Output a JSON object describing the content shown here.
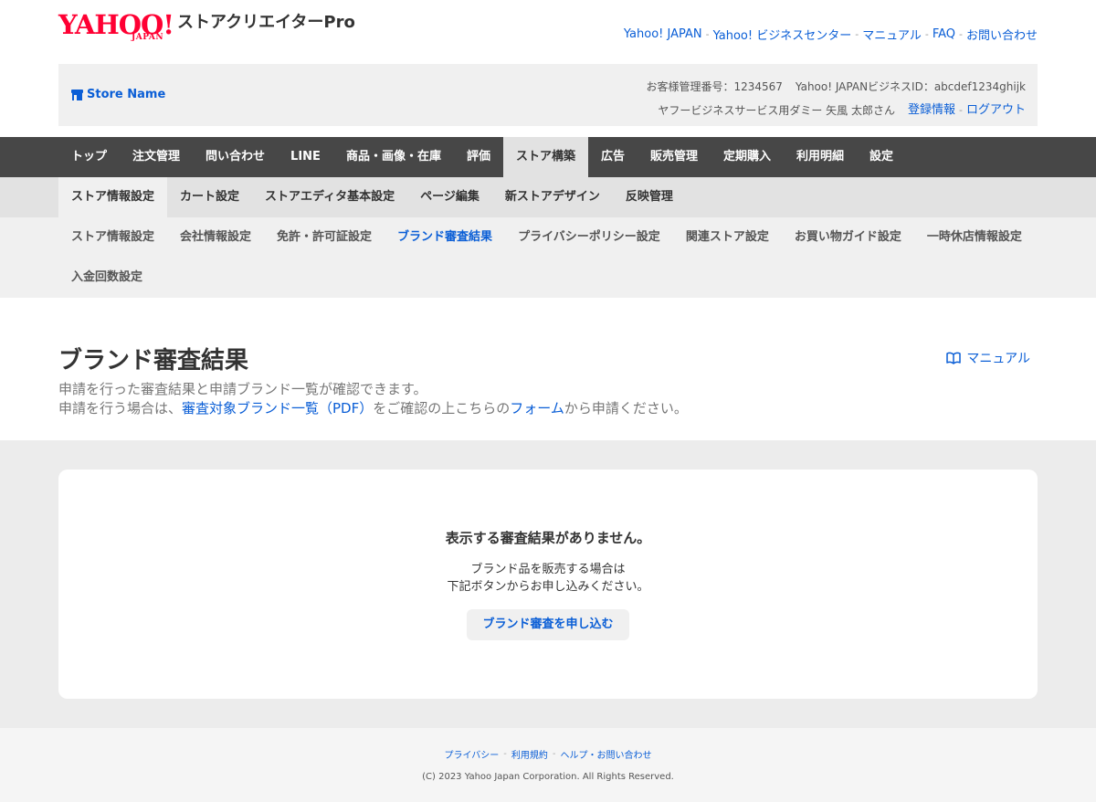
{
  "header": {
    "logo_text": "YAHOO!",
    "logo_japan": "JAPAN",
    "logo_sub": "ストアクリエイターPro",
    "links": [
      {
        "label": "Yahoo! JAPAN"
      },
      {
        "label": "Yahoo! ビジネスセンター"
      },
      {
        "label": "マニュアル"
      },
      {
        "label": "FAQ"
      },
      {
        "label": "お問い合わせ"
      }
    ]
  },
  "store": {
    "name": "Store Name",
    "customer_no": "お客様管理番号：1234567",
    "business_id": "Yahoo! JAPANビジネスID：abcdef1234ghijk",
    "user": "ヤフービジネスサービス用ダミー 矢風 太郎さん",
    "registration_label": "登録情報",
    "logout_label": "ログアウト"
  },
  "nav_main": [
    {
      "label": "トップ"
    },
    {
      "label": "注文管理"
    },
    {
      "label": "問い合わせ"
    },
    {
      "label": "LINE"
    },
    {
      "label": "商品・画像・在庫"
    },
    {
      "label": "評価"
    },
    {
      "label": "ストア構築"
    },
    {
      "label": "広告"
    },
    {
      "label": "販売管理"
    },
    {
      "label": "定期購入"
    },
    {
      "label": "利用明細"
    },
    {
      "label": "設定"
    }
  ],
  "nav_sub": [
    {
      "label": "ストア情報設定"
    },
    {
      "label": "カート設定"
    },
    {
      "label": "ストアエディタ基本設定"
    },
    {
      "label": "ページ編集"
    },
    {
      "label": "新ストアデザイン"
    },
    {
      "label": "反映管理"
    }
  ],
  "nav_third": [
    {
      "label": "ストア情報設定"
    },
    {
      "label": "会社情報設定"
    },
    {
      "label": "免許・許可証設定"
    },
    {
      "label": "ブランド審査結果"
    },
    {
      "label": "プライバシーポリシー設定"
    },
    {
      "label": "関連ストア設定"
    },
    {
      "label": "お買い物ガイド設定"
    },
    {
      "label": "一時休店情報設定"
    },
    {
      "label": "入金回数設定"
    }
  ],
  "page": {
    "title": "ブランド審査結果",
    "manual_label": "マニュアル",
    "desc_line1": "申請を行った審査結果と申請ブランド一覧が確認できます。",
    "desc_line2_pre": "申請を行う場合は、",
    "desc_link_pdf": "審査対象ブランド一覧（PDF）",
    "desc_line2_mid": "をご確認の上こちらの",
    "desc_link_form": "フォーム",
    "desc_line2_post": "から申請ください。"
  },
  "empty": {
    "title": "表示する審査結果がありません。",
    "text_line1": "ブランド品を販売する場合は",
    "text_line2": "下記ボタンからお申し込みください。",
    "button_label": "ブランド審査を申し込む"
  },
  "footer": {
    "links": [
      {
        "label": "プライバシー"
      },
      {
        "label": "利用規約"
      },
      {
        "label": "ヘルプ・お問い合わせ"
      }
    ],
    "copyright": "(C) 2023 Yahoo Japan Corporation. All Rights Reserved."
  },
  "colors": {
    "brand_red": "#ff0033",
    "link_blue": "#0a5ed6",
    "nav_dark": "#474747"
  }
}
